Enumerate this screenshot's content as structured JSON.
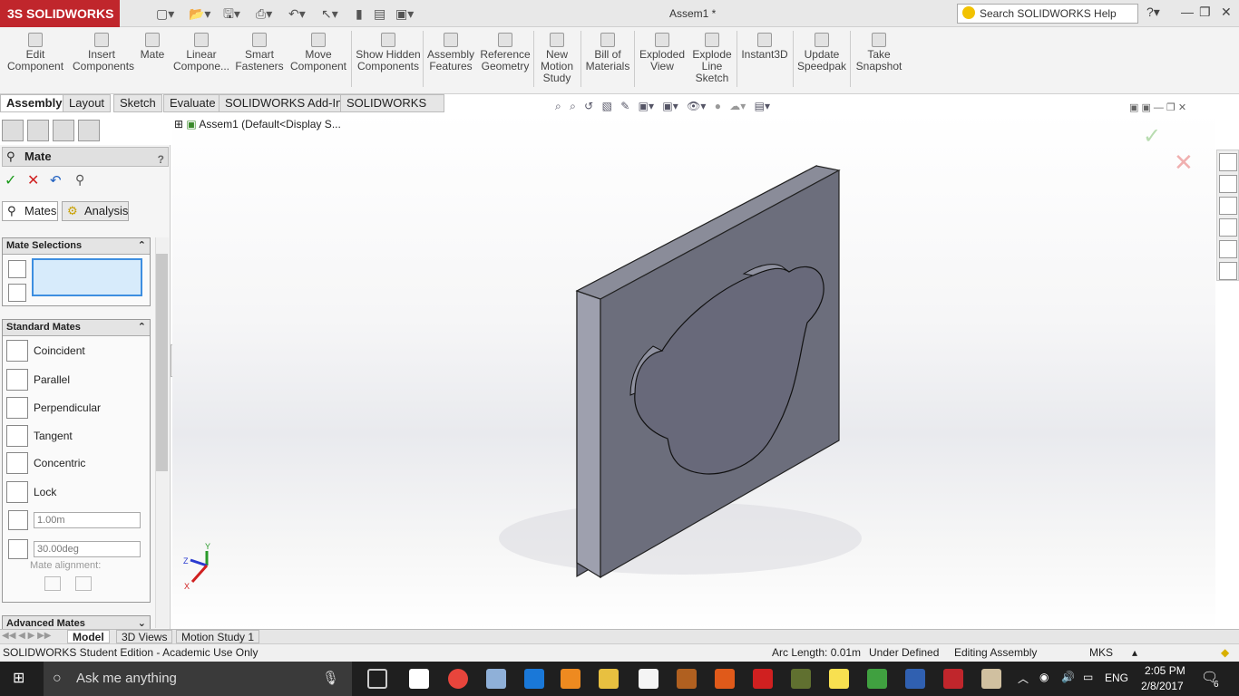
{
  "app": {
    "title": "Assem1 *",
    "logo": "SOLIDWORKS",
    "logo_prefix": "3S"
  },
  "search": {
    "placeholder": "Search SOLIDWORKS Help"
  },
  "ribbon": {
    "edit_component": "Edit Component",
    "insert_components": "Insert Components",
    "mate": "Mate",
    "linear_component": "Linear Compone...",
    "smart_fasteners": "Smart Fasteners",
    "move_component": "Move Component",
    "show_hidden": "Show Hidden Components",
    "assembly_features": "Assembly Features",
    "reference_geometry": "Reference Geometry",
    "new_motion_study": "New Motion Study",
    "bill_of_materials": "Bill of Materials",
    "exploded_view": "Exploded View",
    "explode_line_sketch": "Explode Line Sketch",
    "instant3d": "Instant3D",
    "update_speedpak": "Update Speedpak",
    "take_snapshot": "Take Snapshot"
  },
  "command_tabs": [
    "Assembly",
    "Layout",
    "Sketch",
    "Evaluate",
    "SOLIDWORKS Add-Ins",
    "SOLIDWORKS MBD"
  ],
  "tree": {
    "root": "Assem1  (Default<Display S..."
  },
  "property_manager": {
    "title": "Mate",
    "help": "?",
    "tab_mates": "Mates",
    "tab_analysis": "Analysis",
    "mate_selections": "Mate Selections",
    "standard_mates": "Standard Mates",
    "mates": [
      "Coincident",
      "Parallel",
      "Perpendicular",
      "Tangent",
      "Concentric",
      "Lock"
    ],
    "distance_value": "1.00m",
    "angle_value": "30.00deg",
    "mate_alignment": "Mate alignment:",
    "advanced_mates": "Advanced Mates"
  },
  "bottom_tabs": [
    "Model",
    "3D Views",
    "Motion Study 1"
  ],
  "status": {
    "left": "SOLIDWORKS Student Edition - Academic Use Only",
    "arc_length": "Arc Length: 0.01m",
    "defined": "Under Defined",
    "editing": "Editing Assembly",
    "units": "MKS"
  },
  "taskbar": {
    "search": "Ask me anything",
    "lang": "ENG",
    "time": "2:05 PM",
    "date": "2/8/2017",
    "notification_count": "6"
  },
  "colors": {
    "brand": "#c0262c",
    "accept": "#1a9a1a",
    "cancel": "#d02020",
    "part": "#6e7080"
  }
}
